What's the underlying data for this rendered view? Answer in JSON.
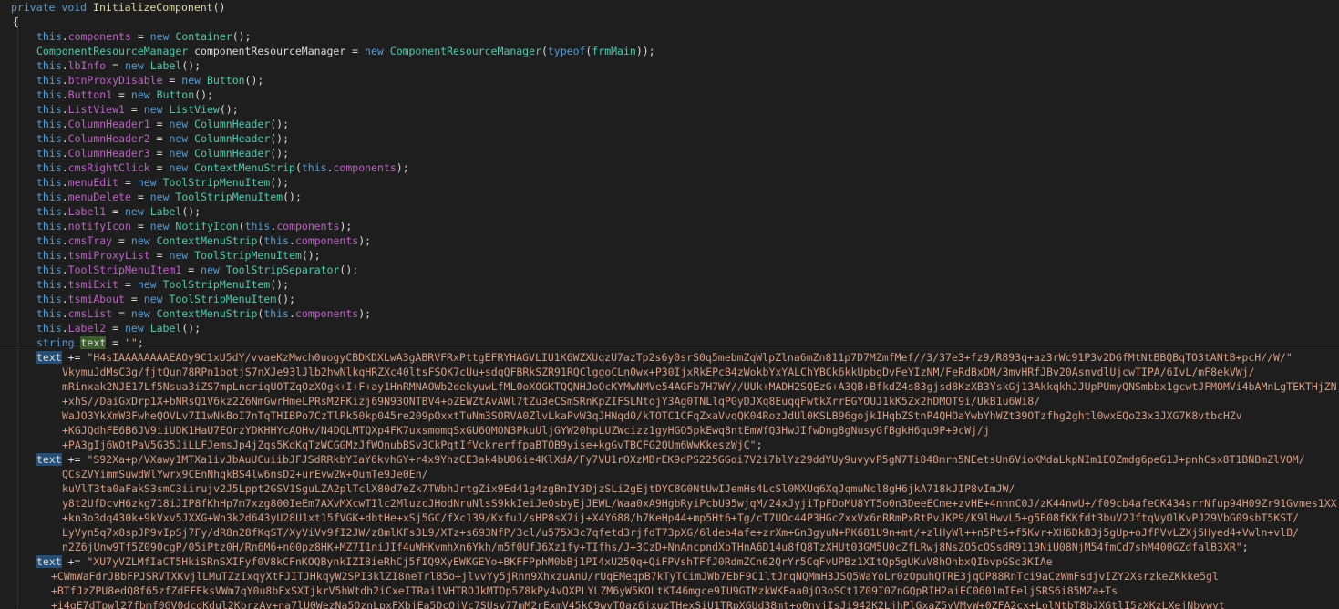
{
  "lines": [
    {
      "indent": 12,
      "segs": [
        {
          "t": "private",
          "c": "kw"
        },
        {
          "t": " ",
          "c": "pl"
        },
        {
          "t": "void",
          "c": "kw"
        },
        {
          "t": " ",
          "c": "pl"
        },
        {
          "t": "InitializeComponent",
          "c": "meth"
        },
        {
          "t": "()",
          "c": "pl"
        }
      ]
    },
    {
      "indent": 14,
      "segs": [
        {
          "t": "{",
          "c": "pl"
        }
      ]
    },
    {
      "indent": 40,
      "segs": [
        {
          "t": "this",
          "c": "kw"
        },
        {
          "t": ".",
          "c": "pl"
        },
        {
          "t": "components",
          "c": "mem"
        },
        {
          "t": " = ",
          "c": "pl"
        },
        {
          "t": "new",
          "c": "kw"
        },
        {
          "t": " ",
          "c": "pl"
        },
        {
          "t": "Container",
          "c": "ty"
        },
        {
          "t": "();",
          "c": "pl"
        }
      ]
    },
    {
      "indent": 40,
      "segs": [
        {
          "t": "ComponentResourceManager",
          "c": "ty"
        },
        {
          "t": " componentResourceManager = ",
          "c": "pl"
        },
        {
          "t": "new",
          "c": "kw"
        },
        {
          "t": " ",
          "c": "pl"
        },
        {
          "t": "ComponentResourceManager",
          "c": "ty"
        },
        {
          "t": "(",
          "c": "pl"
        },
        {
          "t": "typeof",
          "c": "kw"
        },
        {
          "t": "(",
          "c": "pl"
        },
        {
          "t": "frmMain",
          "c": "ty"
        },
        {
          "t": "));",
          "c": "pl"
        }
      ]
    },
    {
      "indent": 40,
      "segs": [
        {
          "t": "this",
          "c": "kw"
        },
        {
          "t": ".",
          "c": "pl"
        },
        {
          "t": "lbInfo",
          "c": "mem"
        },
        {
          "t": " = ",
          "c": "pl"
        },
        {
          "t": "new",
          "c": "kw"
        },
        {
          "t": " ",
          "c": "pl"
        },
        {
          "t": "Label",
          "c": "ty"
        },
        {
          "t": "();",
          "c": "pl"
        }
      ]
    },
    {
      "indent": 40,
      "segs": [
        {
          "t": "this",
          "c": "kw"
        },
        {
          "t": ".",
          "c": "pl"
        },
        {
          "t": "btnProxyDisable",
          "c": "mem"
        },
        {
          "t": " = ",
          "c": "pl"
        },
        {
          "t": "new",
          "c": "kw"
        },
        {
          "t": " ",
          "c": "pl"
        },
        {
          "t": "Button",
          "c": "ty"
        },
        {
          "t": "();",
          "c": "pl"
        }
      ]
    },
    {
      "indent": 40,
      "segs": [
        {
          "t": "this",
          "c": "kw"
        },
        {
          "t": ".",
          "c": "pl"
        },
        {
          "t": "Button1",
          "c": "mem"
        },
        {
          "t": " = ",
          "c": "pl"
        },
        {
          "t": "new",
          "c": "kw"
        },
        {
          "t": " ",
          "c": "pl"
        },
        {
          "t": "Button",
          "c": "ty"
        },
        {
          "t": "();",
          "c": "pl"
        }
      ]
    },
    {
      "indent": 40,
      "segs": [
        {
          "t": "this",
          "c": "kw"
        },
        {
          "t": ".",
          "c": "pl"
        },
        {
          "t": "ListView1",
          "c": "mem"
        },
        {
          "t": " = ",
          "c": "pl"
        },
        {
          "t": "new",
          "c": "kw"
        },
        {
          "t": " ",
          "c": "pl"
        },
        {
          "t": "ListView",
          "c": "ty"
        },
        {
          "t": "();",
          "c": "pl"
        }
      ]
    },
    {
      "indent": 40,
      "segs": [
        {
          "t": "this",
          "c": "kw"
        },
        {
          "t": ".",
          "c": "pl"
        },
        {
          "t": "ColumnHeader1",
          "c": "mem"
        },
        {
          "t": " = ",
          "c": "pl"
        },
        {
          "t": "new",
          "c": "kw"
        },
        {
          "t": " ",
          "c": "pl"
        },
        {
          "t": "ColumnHeader",
          "c": "ty"
        },
        {
          "t": "();",
          "c": "pl"
        }
      ]
    },
    {
      "indent": 40,
      "segs": [
        {
          "t": "this",
          "c": "kw"
        },
        {
          "t": ".",
          "c": "pl"
        },
        {
          "t": "ColumnHeader2",
          "c": "mem"
        },
        {
          "t": " = ",
          "c": "pl"
        },
        {
          "t": "new",
          "c": "kw"
        },
        {
          "t": " ",
          "c": "pl"
        },
        {
          "t": "ColumnHeader",
          "c": "ty"
        },
        {
          "t": "();",
          "c": "pl"
        }
      ]
    },
    {
      "indent": 40,
      "segs": [
        {
          "t": "this",
          "c": "kw"
        },
        {
          "t": ".",
          "c": "pl"
        },
        {
          "t": "ColumnHeader3",
          "c": "mem"
        },
        {
          "t": " = ",
          "c": "pl"
        },
        {
          "t": "new",
          "c": "kw"
        },
        {
          "t": " ",
          "c": "pl"
        },
        {
          "t": "ColumnHeader",
          "c": "ty"
        },
        {
          "t": "();",
          "c": "pl"
        }
      ]
    },
    {
      "indent": 40,
      "segs": [
        {
          "t": "this",
          "c": "kw"
        },
        {
          "t": ".",
          "c": "pl"
        },
        {
          "t": "cmsRightClick",
          "c": "mem"
        },
        {
          "t": " = ",
          "c": "pl"
        },
        {
          "t": "new",
          "c": "kw"
        },
        {
          "t": " ",
          "c": "pl"
        },
        {
          "t": "ContextMenuStrip",
          "c": "ty"
        },
        {
          "t": "(",
          "c": "pl"
        },
        {
          "t": "this",
          "c": "kw"
        },
        {
          "t": ".",
          "c": "pl"
        },
        {
          "t": "components",
          "c": "mem"
        },
        {
          "t": ");",
          "c": "pl"
        }
      ]
    },
    {
      "indent": 40,
      "segs": [
        {
          "t": "this",
          "c": "kw"
        },
        {
          "t": ".",
          "c": "pl"
        },
        {
          "t": "menuEdit",
          "c": "mem"
        },
        {
          "t": " = ",
          "c": "pl"
        },
        {
          "t": "new",
          "c": "kw"
        },
        {
          "t": " ",
          "c": "pl"
        },
        {
          "t": "ToolStripMenuItem",
          "c": "ty"
        },
        {
          "t": "();",
          "c": "pl"
        }
      ]
    },
    {
      "indent": 40,
      "segs": [
        {
          "t": "this",
          "c": "kw"
        },
        {
          "t": ".",
          "c": "pl"
        },
        {
          "t": "menuDelete",
          "c": "mem"
        },
        {
          "t": " = ",
          "c": "pl"
        },
        {
          "t": "new",
          "c": "kw"
        },
        {
          "t": " ",
          "c": "pl"
        },
        {
          "t": "ToolStripMenuItem",
          "c": "ty"
        },
        {
          "t": "();",
          "c": "pl"
        }
      ]
    },
    {
      "indent": 40,
      "segs": [
        {
          "t": "this",
          "c": "kw"
        },
        {
          "t": ".",
          "c": "pl"
        },
        {
          "t": "Label1",
          "c": "mem"
        },
        {
          "t": " = ",
          "c": "pl"
        },
        {
          "t": "new",
          "c": "kw"
        },
        {
          "t": " ",
          "c": "pl"
        },
        {
          "t": "Label",
          "c": "ty"
        },
        {
          "t": "();",
          "c": "pl"
        }
      ]
    },
    {
      "indent": 40,
      "segs": [
        {
          "t": "this",
          "c": "kw"
        },
        {
          "t": ".",
          "c": "pl"
        },
        {
          "t": "notifyIcon",
          "c": "mem"
        },
        {
          "t": " = ",
          "c": "pl"
        },
        {
          "t": "new",
          "c": "kw"
        },
        {
          "t": " ",
          "c": "pl"
        },
        {
          "t": "NotifyIcon",
          "c": "ty"
        },
        {
          "t": "(",
          "c": "pl"
        },
        {
          "t": "this",
          "c": "kw"
        },
        {
          "t": ".",
          "c": "pl"
        },
        {
          "t": "components",
          "c": "mem"
        },
        {
          "t": ");",
          "c": "pl"
        }
      ]
    },
    {
      "indent": 40,
      "segs": [
        {
          "t": "this",
          "c": "kw"
        },
        {
          "t": ".",
          "c": "pl"
        },
        {
          "t": "cmsTray",
          "c": "mem"
        },
        {
          "t": " = ",
          "c": "pl"
        },
        {
          "t": "new",
          "c": "kw"
        },
        {
          "t": " ",
          "c": "pl"
        },
        {
          "t": "ContextMenuStrip",
          "c": "ty"
        },
        {
          "t": "(",
          "c": "pl"
        },
        {
          "t": "this",
          "c": "kw"
        },
        {
          "t": ".",
          "c": "pl"
        },
        {
          "t": "components",
          "c": "mem"
        },
        {
          "t": ");",
          "c": "pl"
        }
      ]
    },
    {
      "indent": 40,
      "segs": [
        {
          "t": "this",
          "c": "kw"
        },
        {
          "t": ".",
          "c": "pl"
        },
        {
          "t": "tsmiProxyList",
          "c": "mem"
        },
        {
          "t": " = ",
          "c": "pl"
        },
        {
          "t": "new",
          "c": "kw"
        },
        {
          "t": " ",
          "c": "pl"
        },
        {
          "t": "ToolStripMenuItem",
          "c": "ty"
        },
        {
          "t": "();",
          "c": "pl"
        }
      ]
    },
    {
      "indent": 40,
      "segs": [
        {
          "t": "this",
          "c": "kw"
        },
        {
          "t": ".",
          "c": "pl"
        },
        {
          "t": "ToolStripMenuItem1",
          "c": "mem"
        },
        {
          "t": " = ",
          "c": "pl"
        },
        {
          "t": "new",
          "c": "kw"
        },
        {
          "t": " ",
          "c": "pl"
        },
        {
          "t": "ToolStripSeparator",
          "c": "ty"
        },
        {
          "t": "();",
          "c": "pl"
        }
      ]
    },
    {
      "indent": 40,
      "segs": [
        {
          "t": "this",
          "c": "kw"
        },
        {
          "t": ".",
          "c": "pl"
        },
        {
          "t": "tsmiExit",
          "c": "mem"
        },
        {
          "t": " = ",
          "c": "pl"
        },
        {
          "t": "new",
          "c": "kw"
        },
        {
          "t": " ",
          "c": "pl"
        },
        {
          "t": "ToolStripMenuItem",
          "c": "ty"
        },
        {
          "t": "();",
          "c": "pl"
        }
      ]
    },
    {
      "indent": 40,
      "segs": [
        {
          "t": "this",
          "c": "kw"
        },
        {
          "t": ".",
          "c": "pl"
        },
        {
          "t": "tsmiAbout",
          "c": "mem"
        },
        {
          "t": " = ",
          "c": "pl"
        },
        {
          "t": "new",
          "c": "kw"
        },
        {
          "t": " ",
          "c": "pl"
        },
        {
          "t": "ToolStripMenuItem",
          "c": "ty"
        },
        {
          "t": "();",
          "c": "pl"
        }
      ]
    },
    {
      "indent": 40,
      "segs": [
        {
          "t": "this",
          "c": "kw"
        },
        {
          "t": ".",
          "c": "pl"
        },
        {
          "t": "cmsList",
          "c": "mem"
        },
        {
          "t": " = ",
          "c": "pl"
        },
        {
          "t": "new",
          "c": "kw"
        },
        {
          "t": " ",
          "c": "pl"
        },
        {
          "t": "ContextMenuStrip",
          "c": "ty"
        },
        {
          "t": "(",
          "c": "pl"
        },
        {
          "t": "this",
          "c": "kw"
        },
        {
          "t": ".",
          "c": "pl"
        },
        {
          "t": "components",
          "c": "mem"
        },
        {
          "t": ");",
          "c": "pl"
        }
      ]
    },
    {
      "indent": 40,
      "segs": [
        {
          "t": "this",
          "c": "kw"
        },
        {
          "t": ".",
          "c": "pl"
        },
        {
          "t": "Label2",
          "c": "mem"
        },
        {
          "t": " = ",
          "c": "pl"
        },
        {
          "t": "new",
          "c": "kw"
        },
        {
          "t": " ",
          "c": "pl"
        },
        {
          "t": "Label",
          "c": "ty"
        },
        {
          "t": "();",
          "c": "pl"
        }
      ]
    },
    {
      "indent": 40,
      "segs": [
        {
          "t": "string",
          "c": "kw"
        },
        {
          "t": " ",
          "c": "pl"
        },
        {
          "t": "text",
          "c": "hl"
        },
        {
          "t": " = ",
          "c": "pl"
        },
        {
          "t": "\"\"",
          "c": "str"
        },
        {
          "t": ";",
          "c": "pl"
        }
      ]
    },
    {
      "indent": 40,
      "segs": [
        {
          "t": "text",
          "c": "hl2"
        },
        {
          "t": " += ",
          "c": "pl"
        },
        {
          "t": "\"H4sIAAAAAAAAEAOy9C1xU5dY/vvaeKzMwch0uogyCBDKDXLwA3gABRVFRxPttgEFRYHAGVLIU1K6WZXUqzU7azTp2s6y0srS0q5mebmZqWlpZlna6mZn811p7D7MZmfMef//3/37e3+fz9/R893q+az3rWc91P3v2DGfMtNtBBQBqTO3tANtB+pcH//W/\"",
          "c": "str"
        }
      ]
    },
    {
      "indent": 68,
      "segs": [
        {
          "t": "VkymuJdMsC3g/fjtQun78RPn1botjS7nXJe93lJlb2hwNlkqHRZXc40ltsFSOK7cUu+sdqQFBRkSZR91RQClggoCLn0wx+P30IjxRkEPcB4zWokbYxYALChYBCk6kkUpbgDvFeYIzNM/FeRdBxDM/3mvHRfJBv20AsnvdlUjcwTIPA/6IvL/mF8ekVWj/",
          "c": "str"
        }
      ]
    },
    {
      "indent": 68,
      "segs": [
        {
          "t": "mRinxak2NJE17Lf5Nsua3iZS7mpLncriqUOTZqOzXOgk+I+F+ay1HnRMNAOWb2dekyuwLfML0oXOGKTQQNHJoOcKYMwNMVe54AGFb7H7WY//UUk+MADH2SQEzG+A3QB+BfkdZ4s83gjsd8KzXB3YskGj13AkkqkhJJUpPUmyQNSmbbx1gcwtJFMOMVi4bAMnLgTEKTHjZN",
          "c": "str"
        }
      ]
    },
    {
      "indent": 68,
      "segs": [
        {
          "t": "+xhS//DaiGxDrp1X+bNRsQ1V6kz2Z6NmGwrHmeLPRsM2FKizj69N93QNTBV4+oZEWZtAvAWl7tZu3eCSmSRnKpZIFSLNtojY3Ag0TNLlqPGyDJXq8EuqqFwtkXrrEGYOUJ1kK5Zx2hDMOT9i/UkB1u6Wi8/",
          "c": "str"
        }
      ]
    },
    {
      "indent": 68,
      "segs": [
        {
          "t": "WaJO3YkXmW3FwheQOVLv7I1wNkBoI7nTqTHIBPo7CzTlPk50kp045re209pOxxtTuNm3SORVA0ZlvLkaPvW3qJHNqd0/kTOTC1CFqZxaVvqQK04RozJdUl0KSLB96gojkIHqbZStnP4QHOaYwbYhWZt39OTzfhg2ghtl0wxEQo23x3JXG7K8vtbcHZv",
          "c": "str"
        }
      ]
    },
    {
      "indent": 68,
      "segs": [
        {
          "t": "+KGJQdhFE6B6JV9iiUDK1HaU7EOrzYDKHHYcAOHv/N4DQLMTQXp4FK7uxsmomqSxGU6QMON3PkuUljGYW20hpLUZWcizz1gyHGO5pkEwq8ntEmWfQ3HwJIfwDng8gNusyGfBgkH6qu9P+9cWj/j",
          "c": "str"
        }
      ]
    },
    {
      "indent": 68,
      "segs": [
        {
          "t": "+PA3gIj6WOtPaV5G35JiLLFJemsJp4jZqs5KdKqTzWCGGMzJfWOnubBSv3CkPqtIfVckrerffpaBTOB9yise+kgGvTBCFG2QUm6WwKkeszWjC\"",
          "c": "str"
        },
        {
          "t": ";",
          "c": "pl"
        }
      ]
    },
    {
      "indent": 40,
      "segs": [
        {
          "t": "text",
          "c": "hl2"
        },
        {
          "t": " += ",
          "c": "pl"
        },
        {
          "t": "\"S92Xa+p/VXawy1MTXa1ivJbAuUCuiibJFJSdRRkbYIaY6kvhGY+r4x9YhzCE3ak4bU06ie4KlXdA/Fy7VU1rOXzMBrEK9dPS225GGoi7V2i7blYz29ddYUy9uvyvP5gN7Ti848mrn5NEetsUn6VioKMdaLkpNIm1EOZmdg6peG1J+pnhCsx8T1BNBmZlVOM/",
          "c": "str"
        }
      ]
    },
    {
      "indent": 68,
      "segs": [
        {
          "t": "QCsZVYimmSuwdWlYwrx9CEnNhqkBS4lw6nsD2+urEvw2W+OumTe9Je0En/",
          "c": "str"
        }
      ]
    },
    {
      "indent": 68,
      "segs": [
        {
          "t": "kuVlT3ta0aFakS3smC3iirujv2J5Lppt2GSV1SguLZA2plTclX80d7eZk7TWbhJrtgZix9Ed41g4zgBnIY3DjzSLi2gEjtDYC8G0NtUwIJemHs4LcSl0MXUq6XqJqmuNcl8gH6jkA718kJIP8vImJW/",
          "c": "str"
        }
      ]
    },
    {
      "indent": 68,
      "segs": [
        {
          "t": "y8t2UfDcvH6zkg718iJIP8fKhHp7m7xzg800IeEm7AXvMXcwTIlc2MluzcJHodNruNlsS9kkIeiJe0sbyEjJEWL/Waa0xA9HgbRyiPcbU95wjqM/24xJyjiTpFDoMU8YT5o0n3DeeECme+zvHE+4nnnC0J/zK44nwU+/f09cb4afeCK434srrNfup94H09Zr91Gvmes1XX",
          "c": "str"
        }
      ]
    },
    {
      "indent": 68,
      "segs": [
        {
          "t": "+kn3o3dq430k+9kVxv5JXXG+Wn3k2d643yU28U1xt15fVGK+dbtHe+xSj5GC/fXc139/KxfuJ/sHP8sX7ij+X4Y688/h7KeHp44+mp5Ht6+Tg/cT7UOc44P3HGcZxxVx6nRRmPxRtPvJKP9/K9lHwvL5+g5B08fKKfdt3buV2JftqVyOlKvPJ29VbG09sbT5KST/",
          "c": "str"
        }
      ]
    },
    {
      "indent": 68,
      "segs": [
        {
          "t": "LyVyn5q7x8spJP9vIpSj7Fy/dR8n28fKqST/XyViVv9fI2JW/z8mlKFs3L9/XTz+s693NfP/3cl/u575X3c7qfetd3rjfdT73pXG/6ldeb4afe+zrXm+Gn3gyuN+PK681U9n+mt/+zlHyWl++n5Pt5+f5Kvr+XH6DkB3j5gUp+oJfPVvLZXj5Hyed4+Vwln+vlB/",
          "c": "str"
        }
      ]
    },
    {
      "indent": 68,
      "segs": [
        {
          "t": "n2Z6jUnw9Tf5Z090cgP/05iPtz0H/Rn6M6+n00pz8HK+MZ7I1niJIf4uWHKvmhXn6Ykh/m5f0UfJ6Xz1fy+TIfhs/J+3CzD+NnAncpndXpTHnA6D14u8fQ8TzXHUt03GM5U0cZfLRwj8NsZO5cOSsdR9119NiU08NjM54fmCd7shM400GZdfalB3XR\"",
          "c": "str"
        },
        {
          "t": ";",
          "c": "pl"
        }
      ]
    },
    {
      "indent": 40,
      "segs": [
        {
          "t": "text",
          "c": "hl2"
        },
        {
          "t": " += ",
          "c": "pl"
        },
        {
          "t": "\"XU7yVZLMfIaCT5HkiSRnSXIFyf0V8kCFnKOQBynkIZI8ieRhCj5fIQ9XyEWKGEYo+BKFFPphM0bBj1PI4xU25Qq+QiFPVshTFfJ0RdmZCn62QrYr5CqFvUPBz1XItQp5gUKuV8hOhbxQIbvpGSc3KIAe",
          "c": "str"
        }
      ]
    },
    {
      "indent": 56,
      "segs": [
        {
          "t": "+CWmWaFdrJBbFPJSRVTXKvjlLMuTZzIxqyXtFJITJHkqyW2SPI3klZI8neTrlB5o+jlvvYy5jRnn9XhxzuAnU/rUqEMeqpB7kTyTCimJWb7EbF9C1ltJnqNQMmH3JSQ5WaYoLr0zOpuhQTRE3jqOP88RnTci9aCzWmFsdjvIZY2XsrzkeZKkke5gl",
          "c": "str"
        }
      ]
    },
    {
      "indent": 56,
      "segs": [
        {
          "t": "+BTfJzZPU8edQ8f65zfZdEFEksVWm7qY0u8bFxSXIjkrV5hWtdh2iCxeITRai1VHTROJkMTDp5Z8kPy4vQXPLYLZM6yW5KOLtKT46mgce9IU9GTMzkWKEaa0jO3oSCt1Z09I0ZnGQpRIH2aiEC0601mIEeljSRS6i85MZa+Ts",
          "c": "str"
        }
      ]
    },
    {
      "indent": 56,
      "segs": [
        {
          "t": "+i4qE7dTpwl27fbmf0GV0dcdKdul2KbrzAy+na7lU0WezNa5OznLpxFXbjEa5DcQjVc7SUsv77mM2rExmV45kC9wvTQaz6jxuzTHexSiU1TRpXGUd38mt+o0nyjIsJi942K2LjhPlGxaZ5vVMyW+0ZFA2cx+LolNtbT8bJXGtlI5zXKzLXejNbywyt",
          "c": "str"
        }
      ]
    }
  ]
}
